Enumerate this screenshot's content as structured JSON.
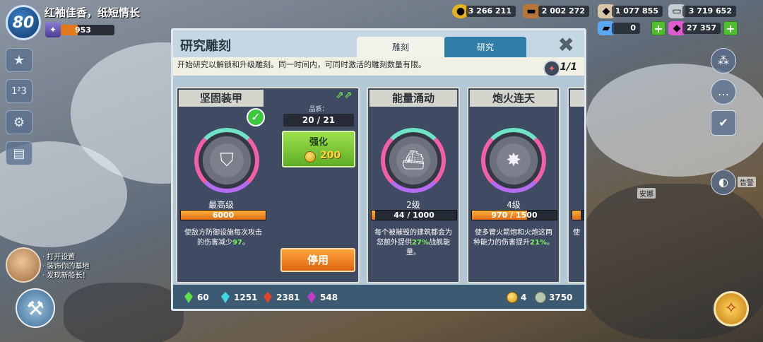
{
  "player": {
    "level": "80",
    "name": "红袖佳香，纸短情长",
    "trophies": "953"
  },
  "resources": {
    "gold": "3 266 211",
    "wood": "2 002 272",
    "stone": "1 077 855",
    "iron": "3 719 652",
    "tickets": "0",
    "diamonds": "27 357"
  },
  "modal": {
    "title": "研究雕刻",
    "tabs": [
      "雕刻",
      "研究"
    ],
    "active_tab": "雕刻",
    "description": "开始研究以解锁和升级雕刻。同一时间内，可同时激活的雕刻数量有限。",
    "active_slots": "1/1",
    "close_label": "✖"
  },
  "selected_card": {
    "title": "坚固装甲",
    "level_label": "最高级",
    "progress_text": "6000",
    "progress_fraction": 1.0,
    "description_pre": "使敌方防御设施每次攻击",
    "description_mid": "的伤害减少",
    "highlight": "97",
    "description_post": "。",
    "quality_label": "品质：",
    "quality_value": "20 / 21",
    "enhance_label": "强化",
    "enhance_cost": "200",
    "disable_label": "停用"
  },
  "cards": [
    {
      "title": "能量涌动",
      "level_label": "2级",
      "progress_text": "44 / 1000",
      "progress_fraction": 0.044,
      "desc_line1": "每个被摧毁的建筑都会为",
      "desc_line2_pre": "您额外提供",
      "highlight": "27%",
      "desc_line2_post": "战舰能",
      "desc_line3": "量。"
    },
    {
      "title": "炮火连天",
      "level_label": "4级",
      "progress_text": "970 / 1500",
      "progress_fraction": 0.647,
      "desc_line1": "使多管火箭炮和火炮这两",
      "desc_line2_pre": "种能力的伤害提升",
      "highlight": "21%",
      "desc_line2_post": "。",
      "desc_line3": ""
    },
    {
      "title": "",
      "desc_line1": "使"
    }
  ],
  "footer": {
    "gems": [
      {
        "value": "60",
        "color": "#5ee04a"
      },
      {
        "value": "1251",
        "color": "#3fd7e0"
      },
      {
        "value": "2381",
        "color": "#e0442e"
      },
      {
        "value": "548",
        "color": "#c43ac9"
      }
    ],
    "gold_count": "4",
    "power_count": "3750"
  },
  "tips": [
    "· 打开设置",
    "· 装饰你的基地",
    "· 发现新船长！"
  ],
  "map_labels": [
    "安娜",
    "告警"
  ]
}
